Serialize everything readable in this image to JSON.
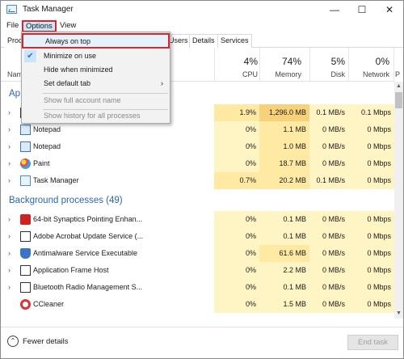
{
  "window": {
    "title": "Task Manager",
    "minimize_glyph": "—",
    "maximize_glyph": "☐",
    "close_glyph": "✕"
  },
  "menu": {
    "file": "File",
    "options": "Options",
    "view": "View"
  },
  "tabs": [
    "Proc",
    "Users",
    "Details",
    "Services"
  ],
  "columns": {
    "name": "Nam",
    "cpu": {
      "pct": "4%",
      "label": "CPU"
    },
    "memory": {
      "pct": "74%",
      "label": "Memory"
    },
    "disk": {
      "pct": "5%",
      "label": "Disk"
    },
    "network": {
      "pct": "0%",
      "label": "Network"
    },
    "extra": {
      "pct": "",
      "label": "P"
    }
  },
  "groups": {
    "apps_partial": "Ap",
    "background": "Background processes (49)"
  },
  "app_rows": [
    {
      "name": "",
      "icon": "app-icon",
      "cpu": "1.9%",
      "memory": "1,296.0 MB",
      "disk": "0.1 MB/s",
      "network": "0.1 Mbps"
    },
    {
      "name": "Notepad",
      "icon": "notepad-icon",
      "cpu": "0%",
      "memory": "1.1 MB",
      "disk": "0 MB/s",
      "network": "0 Mbps"
    },
    {
      "name": "Notepad",
      "icon": "notepad-icon",
      "cpu": "0%",
      "memory": "1.0 MB",
      "disk": "0 MB/s",
      "network": "0 Mbps"
    },
    {
      "name": "Paint",
      "icon": "paint-icon",
      "cpu": "0%",
      "memory": "18.7 MB",
      "disk": "0 MB/s",
      "network": "0 Mbps"
    },
    {
      "name": "Task Manager",
      "icon": "task-manager-icon",
      "cpu": "0.7%",
      "memory": "20.2 MB",
      "disk": "0.1 MB/s",
      "network": "0 Mbps"
    }
  ],
  "bg_rows": [
    {
      "name": "64-bit Synaptics Pointing Enhan...",
      "icon": "synaptics-icon",
      "cpu": "0%",
      "memory": "0.1 MB",
      "disk": "0 MB/s",
      "network": "0 Mbps"
    },
    {
      "name": "Adobe Acrobat Update Service (...",
      "icon": "service-icon",
      "cpu": "0%",
      "memory": "0.1 MB",
      "disk": "0 MB/s",
      "network": "0 Mbps"
    },
    {
      "name": "Antimalware Service Executable",
      "icon": "shield-icon",
      "cpu": "0%",
      "memory": "61.6 MB",
      "disk": "0 MB/s",
      "network": "0 Mbps"
    },
    {
      "name": "Application Frame Host",
      "icon": "window-icon",
      "cpu": "0%",
      "memory": "2.2 MB",
      "disk": "0 MB/s",
      "network": "0 Mbps"
    },
    {
      "name": "Bluetooth Radio Management S...",
      "icon": "service-icon",
      "cpu": "0%",
      "memory": "0.1 MB",
      "disk": "0 MB/s",
      "network": "0 Mbps"
    },
    {
      "name": "CCleaner",
      "icon": "ccleaner-icon",
      "cpu": "0%",
      "memory": "1.5 MB",
      "disk": "0 MB/s",
      "network": "0 Mbps"
    }
  ],
  "options_menu": {
    "always_on_top": "Always on top",
    "minimize_on_use": "Minimize on use",
    "hide_when_minimized": "Hide when minimized",
    "set_default_tab": "Set default tab",
    "show_full_account_name": "Show full account name",
    "show_history": "Show history for all processes",
    "check_glyph": "✔",
    "submenu_glyph": "›"
  },
  "footer": {
    "fewer_details": "Fewer details",
    "fewer_glyph": "⌃",
    "end_task": "End task"
  },
  "scroll": {
    "up_glyph": "▲",
    "down_glyph": "▼"
  },
  "expand_glyph": "›"
}
